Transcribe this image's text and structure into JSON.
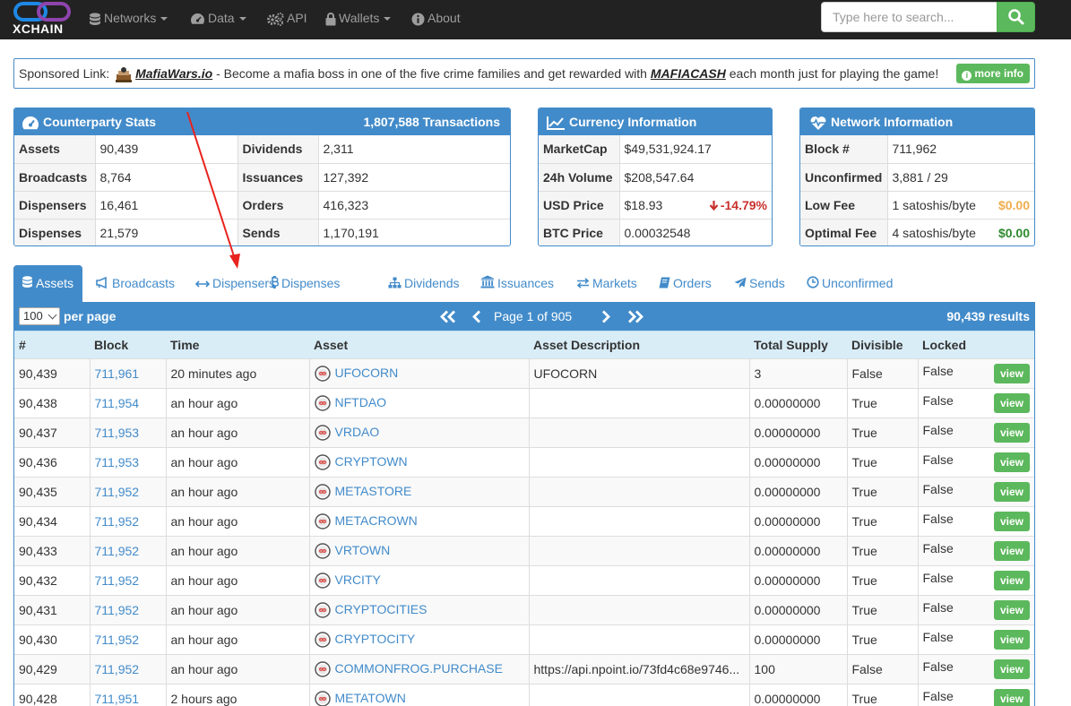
{
  "navbar": {
    "logo_text": "XCHAIN",
    "items": [
      {
        "label": "Networks",
        "icon": "database-icon",
        "caret": true
      },
      {
        "label": "Data",
        "icon": "tachometer-icon",
        "caret": true
      },
      {
        "label": "API",
        "icon": "cogs-icon",
        "caret": false
      },
      {
        "label": "Wallets",
        "icon": "lock-icon",
        "caret": true
      },
      {
        "label": "About",
        "icon": "info-circle-icon",
        "caret": false
      }
    ],
    "search_placeholder": "Type here to search..."
  },
  "sponsor": {
    "prefix": "Sponsored Link:",
    "link": "MafiaWars.io",
    "text1": " - Become a mafia boss in one of the five crime families and get rewarded with ",
    "token": "MAFIACASH",
    "text2": " each month just for playing the game!",
    "button": "more info"
  },
  "counterparty": {
    "title": "Counterparty Stats",
    "transactions": "1,807,588 Transactions",
    "rows": [
      {
        "l1": "Assets",
        "v1": "90,439",
        "l2": "Dividends",
        "v2": "2,311"
      },
      {
        "l1": "Broadcasts",
        "v1": "8,764",
        "l2": "Issuances",
        "v2": "127,392"
      },
      {
        "l1": "Dispensers",
        "v1": "16,461",
        "l2": "Orders",
        "v2": "416,323"
      },
      {
        "l1": "Dispenses",
        "v1": "21,579",
        "l2": "Sends",
        "v2": "1,170,191"
      }
    ]
  },
  "currency": {
    "title": "Currency Information",
    "rows": [
      {
        "label": "MarketCap",
        "value": "$49,531,924.17"
      },
      {
        "label": "24h Volume",
        "value": "$208,547.64"
      },
      {
        "label": "USD Price",
        "value": "$18.93",
        "change": "-14.79%"
      },
      {
        "label": "BTC Price",
        "value": "0.00032548"
      }
    ]
  },
  "network": {
    "title": "Network Information",
    "rows": [
      {
        "label": "Block #",
        "value": "711,962"
      },
      {
        "label": "Unconfirmed",
        "value": "3,881 / 29"
      },
      {
        "label": "Low Fee",
        "value": "1 satoshis/byte",
        "usd": "$0.00",
        "usd_color": "#f0ad4e"
      },
      {
        "label": "Optimal Fee",
        "value": "4 satoshis/byte",
        "usd": "$0.00",
        "usd_color": "#2d8a2d"
      }
    ]
  },
  "tabs": [
    {
      "label": "Assets",
      "icon": "database-icon",
      "active": true
    },
    {
      "label": "Broadcasts",
      "icon": "bullhorn-icon"
    },
    {
      "label": "Dispensers",
      "icon": "arrows-h-icon"
    },
    {
      "label": "Dispenses",
      "icon": "bitcoin-icon"
    },
    {
      "label": "Dividends",
      "icon": "sitemap-icon"
    },
    {
      "label": "Issuances",
      "icon": "bank-icon"
    },
    {
      "label": "Markets",
      "icon": "exchange-icon"
    },
    {
      "label": "Orders",
      "icon": "book-icon"
    },
    {
      "label": "Sends",
      "icon": "paper-plane-icon"
    },
    {
      "label": "Unconfirmed",
      "icon": "clock-icon"
    }
  ],
  "table": {
    "per_page_value": "100",
    "per_page_label": "per page",
    "page_text": "Page 1 of 905",
    "results": "90,439 results",
    "columns": [
      "#",
      "Block",
      "Time",
      "Asset",
      "Asset Description",
      "Total Supply",
      "Divisible",
      "Locked"
    ],
    "view_label": "view",
    "rows": [
      [
        "90,439",
        "711,961",
        "20 minutes ago",
        "UFOCORN",
        "UFOCORN",
        "3",
        "False",
        "False"
      ],
      [
        "90,438",
        "711,954",
        "an hour ago",
        "NFTDAO",
        "",
        "0.00000000",
        "True",
        "False"
      ],
      [
        "90,437",
        "711,953",
        "an hour ago",
        "VRDAO",
        "",
        "0.00000000",
        "True",
        "False"
      ],
      [
        "90,436",
        "711,953",
        "an hour ago",
        "CRYPTOWN",
        "",
        "0.00000000",
        "True",
        "False"
      ],
      [
        "90,435",
        "711,952",
        "an hour ago",
        "METASTORE",
        "",
        "0.00000000",
        "True",
        "False"
      ],
      [
        "90,434",
        "711,952",
        "an hour ago",
        "METACROWN",
        "",
        "0.00000000",
        "True",
        "False"
      ],
      [
        "90,433",
        "711,952",
        "an hour ago",
        "VRTOWN",
        "",
        "0.00000000",
        "True",
        "False"
      ],
      [
        "90,432",
        "711,952",
        "an hour ago",
        "VRCITY",
        "",
        "0.00000000",
        "True",
        "False"
      ],
      [
        "90,431",
        "711,952",
        "an hour ago",
        "CRYPTOCITIES",
        "",
        "0.00000000",
        "True",
        "False"
      ],
      [
        "90,430",
        "711,952",
        "an hour ago",
        "CRYPTOCITY",
        "",
        "0.00000000",
        "True",
        "False"
      ],
      [
        "90,429",
        "711,952",
        "an hour ago",
        "COMMONFROG.PURCHASE",
        "https://api.npoint.io/73fd4c68e9746...",
        "100",
        "False",
        "False"
      ],
      [
        "90,428",
        "711,951",
        "2 hours ago",
        "METATOWN",
        "",
        "0.00000000",
        "True",
        "False"
      ]
    ]
  }
}
